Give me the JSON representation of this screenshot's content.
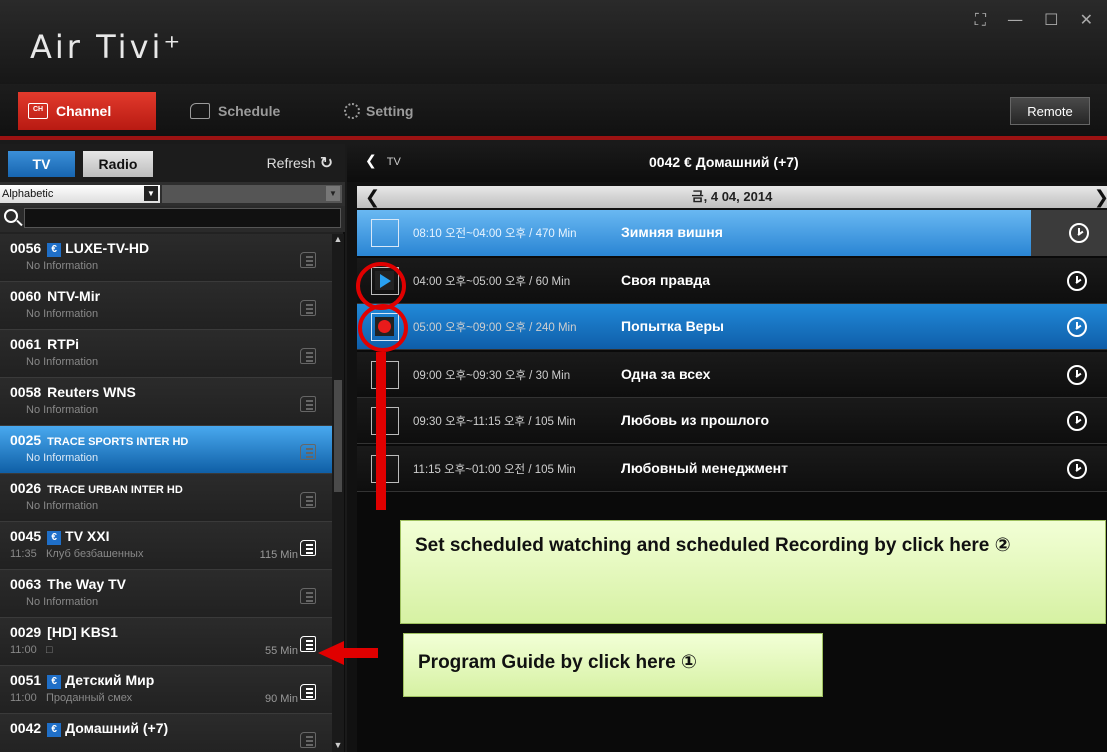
{
  "app": {
    "title": "Air Tivi⁺",
    "window_controls": [
      "⛶",
      "—",
      "☐",
      "✕"
    ]
  },
  "nav": {
    "channel_icon_text": "CH",
    "channel_label": "Channel",
    "schedule_label": "Schedule",
    "setting_label": "Setting",
    "remote_label": "Remote"
  },
  "left_panel": {
    "tab_tv": "TV",
    "tab_radio": "Radio",
    "refresh_label": "Refresh",
    "refresh_icon": "refresh-icon",
    "sort_value": "Alphabetic",
    "search_placeholder": ""
  },
  "channels": [
    {
      "number": "0056",
      "euro": true,
      "name": "LUXE-TV-HD",
      "time": "",
      "info": "No Information",
      "duration": "",
      "small_name": false,
      "guide_active": false,
      "selected": false
    },
    {
      "number": "0060",
      "euro": false,
      "name": "NTV-Mir",
      "time": "",
      "info": "No Information",
      "duration": "",
      "small_name": false,
      "guide_active": false,
      "selected": false
    },
    {
      "number": "0061",
      "euro": false,
      "name": "RTPi",
      "time": "",
      "info": "No Information",
      "duration": "",
      "small_name": false,
      "guide_active": false,
      "selected": false
    },
    {
      "number": "0058",
      "euro": false,
      "name": "Reuters WNS",
      "time": "",
      "info": "No Information",
      "duration": "",
      "small_name": false,
      "guide_active": false,
      "selected": false
    },
    {
      "number": "0025",
      "euro": false,
      "name": "TRACE SPORTS INTER HD",
      "time": "",
      "info": "No Information",
      "duration": "",
      "small_name": true,
      "guide_active": false,
      "selected": true
    },
    {
      "number": "0026",
      "euro": false,
      "name": "TRACE URBAN INTER HD",
      "time": "",
      "info": "No Information",
      "duration": "",
      "small_name": true,
      "guide_active": false,
      "selected": false
    },
    {
      "number": "0045",
      "euro": true,
      "name": "TV XXI",
      "time": "11:35",
      "info": "Клуб безбашенных",
      "duration": "115 Min",
      "small_name": false,
      "guide_active": true,
      "selected": false
    },
    {
      "number": "0063",
      "euro": false,
      "name": "The Way TV",
      "time": "",
      "info": "No Information",
      "duration": "",
      "small_name": false,
      "guide_active": false,
      "selected": false
    },
    {
      "number": "0029",
      "euro": false,
      "name": "[HD] KBS1",
      "time": "11:00",
      "info": "□",
      "duration": "55 Min",
      "small_name": false,
      "guide_active": true,
      "selected": false
    },
    {
      "number": "0051",
      "euro": true,
      "name": "Детский Мир",
      "time": "11:00",
      "info": "Проданный смех",
      "duration": "90 Min",
      "small_name": false,
      "guide_active": true,
      "selected": false
    },
    {
      "number": "0042",
      "euro": true,
      "name": "Домашний (+7)",
      "time": "",
      "info": "",
      "duration": "",
      "small_name": false,
      "guide_active": false,
      "selected": false
    }
  ],
  "right_panel": {
    "back_label": "TV",
    "channel_header": "0042 € Домашний (+7)",
    "date": "금, 4 04, 2014",
    "programs": [
      {
        "time": "08:10 오전~04:00 오후 / 470 Min",
        "title": "Зимняя вишня",
        "state": "playing"
      },
      {
        "time": "04:00 오후~05:00 오후 / 60 Min",
        "title": "Своя правда",
        "state": "play-button"
      },
      {
        "time": "05:00 오후~09:00 오후 / 240 Min",
        "title": "Попытка Веры",
        "state": "recording"
      },
      {
        "time": "09:00 오후~09:30 오후 / 30 Min",
        "title": "Одна за всех",
        "state": "none"
      },
      {
        "time": "09:30 오후~11:15 오후 / 105 Min",
        "title": "Любовь из прошлого",
        "state": "none"
      },
      {
        "time": "11:15 오후~01:00 오전 / 105 Min",
        "title": "Любовный менеджмент",
        "state": "none"
      }
    ]
  },
  "annotations": {
    "callout_2": "Set scheduled watching and scheduled Recording by click here ②",
    "callout_1": "Program Guide by click here ①",
    "highlight_color": "#e00000"
  },
  "colors": {
    "accent_red": "#c62217",
    "selected_blue": "#2b86d4",
    "callout_green": "#e3f7bd"
  }
}
